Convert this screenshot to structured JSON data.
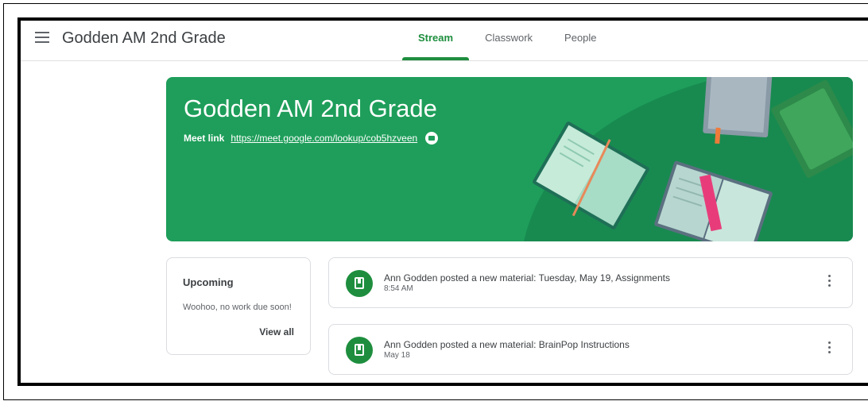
{
  "header": {
    "title": "Godden AM 2nd Grade",
    "tabs": [
      {
        "label": "Stream",
        "active": true
      },
      {
        "label": "Classwork",
        "active": false
      },
      {
        "label": "People",
        "active": false
      }
    ]
  },
  "banner": {
    "title": "Godden AM 2nd Grade",
    "meet_label": "Meet link",
    "meet_url": "https://meet.google.com/lookup/cob5hzveen",
    "color": "#1e9e5a"
  },
  "upcoming": {
    "title": "Upcoming",
    "message": "Woohoo, no work due soon!",
    "view_all": "View all"
  },
  "posts": [
    {
      "title": "Ann Godden posted a new material: Tuesday, May 19, Assignments",
      "time": "8:54 AM",
      "icon": "material-book-icon"
    },
    {
      "title": "Ann Godden posted a new material: BrainPop Instructions",
      "time": "May 18",
      "icon": "material-book-icon"
    }
  ],
  "colors": {
    "accent": "#1e8e3e",
    "text": "#3c4043"
  }
}
